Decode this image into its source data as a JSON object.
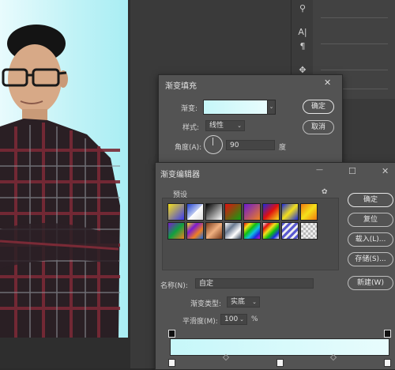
{
  "fill_dialog": {
    "title": "渐变填充",
    "gradient_label": "渐变:",
    "style_label": "样式:",
    "style_value": "线性",
    "angle_label": "角度(A):",
    "angle_value": "90",
    "degree_unit": "度",
    "ok": "确定",
    "cancel": "取消",
    "close": "✕"
  },
  "editor": {
    "title": "渐变编辑器",
    "presets_label": "预设",
    "name_label": "名称(N):",
    "name_value": "自定",
    "type_label": "渐变类型:",
    "type_value": "实底",
    "smooth_label": "平滑度(M):",
    "smooth_value": "100",
    "percent": "%",
    "ok": "确定",
    "reset": "复位",
    "load": "载入(L)...",
    "save": "存储(S)...",
    "new": "新建(W)",
    "gear": "✿",
    "minimize": "—",
    "maximize": "☐",
    "close": "✕"
  },
  "colors": {
    "gradient_start": "#c6f7f9",
    "gradient_end": "#e8fcfd",
    "dialog_bg": "#535353",
    "photo_bg": "#bff2f6"
  },
  "presets": [
    {
      "icon": "fg-bg"
    },
    {
      "icon": "fg-transparent"
    },
    {
      "icon": "black-white"
    },
    {
      "icon": "red-green"
    },
    {
      "icon": "violet-orange"
    },
    {
      "icon": "blue-red-yellow"
    },
    {
      "icon": "blue-yellow-blue"
    },
    {
      "icon": "orange-yellow-orange"
    },
    {
      "icon": "violet-green-orange"
    },
    {
      "icon": "yellow-violet-orange-blue"
    },
    {
      "icon": "copper"
    },
    {
      "icon": "chrome"
    },
    {
      "icon": "spectrum"
    },
    {
      "icon": "transparent-rainbow"
    },
    {
      "icon": "transparent-stripes"
    },
    {
      "icon": "checker"
    }
  ]
}
